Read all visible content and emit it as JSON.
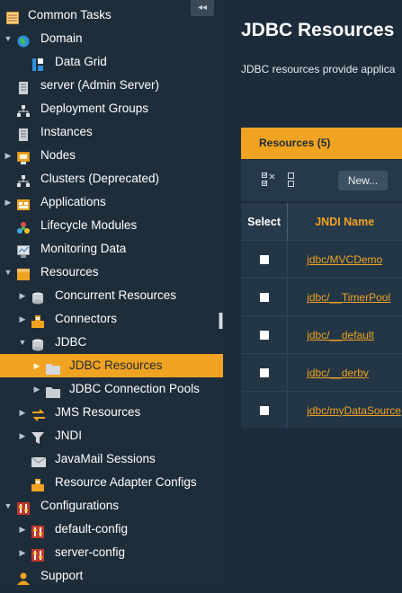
{
  "sidebar": {
    "collapse_icon": "◂◂",
    "items": [
      {
        "label": "Common Tasks",
        "icon": "tasks-icon",
        "expanded": null
      },
      {
        "label": "Domain",
        "icon": "globe-icon",
        "expanded": true
      },
      {
        "label": "Data Grid",
        "icon": "data-grid-icon",
        "expanded": null
      },
      {
        "label": "server (Admin Server)",
        "icon": "server-icon",
        "expanded": null
      },
      {
        "label": "Deployment Groups",
        "icon": "deployment-groups-icon",
        "expanded": null
      },
      {
        "label": "Instances",
        "icon": "instances-icon",
        "expanded": null
      },
      {
        "label": "Nodes",
        "icon": "nodes-icon",
        "expanded": false
      },
      {
        "label": "Clusters (Deprecated)",
        "icon": "clusters-icon",
        "expanded": null
      },
      {
        "label": "Applications",
        "icon": "applications-icon",
        "expanded": false
      },
      {
        "label": "Lifecycle Modules",
        "icon": "lifecycle-icon",
        "expanded": null
      },
      {
        "label": "Monitoring Data",
        "icon": "monitoring-icon",
        "expanded": null
      },
      {
        "label": "Resources",
        "icon": "resources-icon",
        "expanded": true
      },
      {
        "label": "Concurrent Resources",
        "icon": "database-icon",
        "expanded": false
      },
      {
        "label": "Connectors",
        "icon": "connector-icon",
        "expanded": false
      },
      {
        "label": "JDBC",
        "icon": "database-icon",
        "expanded": true
      },
      {
        "label": "JDBC Resources",
        "icon": "folder-icon",
        "expanded": false,
        "selected": true
      },
      {
        "label": "JDBC Connection Pools",
        "icon": "folder-icon",
        "expanded": false
      },
      {
        "label": "JMS Resources",
        "icon": "jms-icon",
        "expanded": false
      },
      {
        "label": "JNDI",
        "icon": "filter-icon",
        "expanded": false
      },
      {
        "label": "JavaMail Sessions",
        "icon": "mail-icon",
        "expanded": null
      },
      {
        "label": "Resource Adapter Configs",
        "icon": "connector-icon",
        "expanded": null
      },
      {
        "label": "Configurations",
        "icon": "config-icon",
        "expanded": true
      },
      {
        "label": "default-config",
        "icon": "config-icon",
        "expanded": false
      },
      {
        "label": "server-config",
        "icon": "config-icon",
        "expanded": false
      },
      {
        "label": "Support",
        "icon": "user-icon",
        "expanded": null
      }
    ]
  },
  "main": {
    "title": "JDBC Resources",
    "description": "JDBC resources provide applica",
    "tab_label": "Resources (5)",
    "toolbar": {
      "select_all_icon": "select-all-icon",
      "deselect_icon": "deselect-all-icon",
      "new_label": "New..."
    },
    "table": {
      "headers": [
        "Select",
        "JNDI Name"
      ],
      "rows": [
        {
          "jndi": "jdbc/MVCDemo"
        },
        {
          "jndi": "jdbc/__TimerPool"
        },
        {
          "jndi": "jdbc/__default"
        },
        {
          "jndi": "jdbc/__derby"
        },
        {
          "jndi": "jdbc/myDataSource"
        }
      ]
    }
  },
  "colors": {
    "accent": "#f0a321",
    "sidebar_bg": "#1e2d3a",
    "content_bg": "#1c2c3a"
  }
}
